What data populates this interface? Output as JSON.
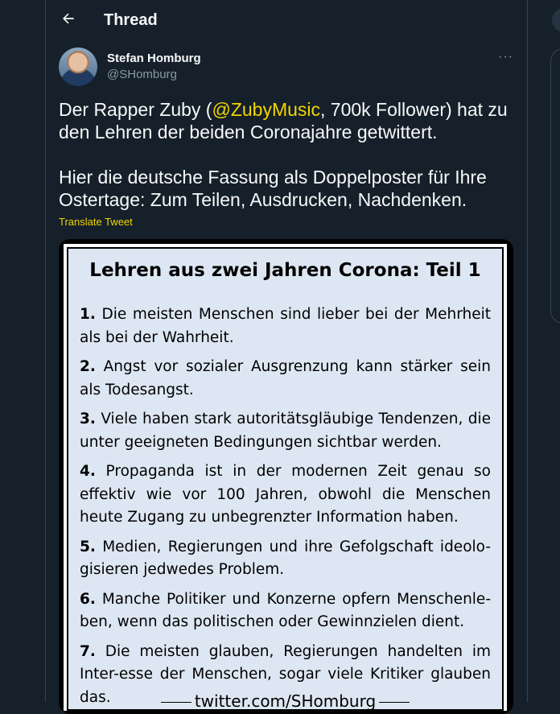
{
  "header": {
    "title": "Thread",
    "back_icon": "arrow-left-icon"
  },
  "author": {
    "name": "Stefan Homburg",
    "handle": "@SHomburg",
    "more_label": "···"
  },
  "tweet": {
    "p1_before": "Der Rapper Zuby (",
    "mention": "@ZubyMusic",
    "p1_after": ", 700k Follower) hat zu den Lehren der beiden Coronajahre getwittert.",
    "p2": "Hier die deutsche Fassung als Doppelposter für Ihre Ostertage: Zum Teilen, Ausdrucken, Nachdenken.",
    "translate_label": "Translate Tweet"
  },
  "poster": {
    "title": "Lehren aus zwei Jahren Corona: Teil 1",
    "lessons": [
      {
        "num": "1.",
        "text": " Die meisten Menschen sind lieber bei der Mehrheit als bei der Wahrheit."
      },
      {
        "num": "2.",
        "text": " Angst vor sozialer Ausgrenzung kann stärker sein als Todesangst."
      },
      {
        "num": "3.",
        "text": " Viele haben stark autoritätsgläubige Tendenzen, die unter geeigneten Bedingungen sichtbar werden."
      },
      {
        "num": "4.",
        "text": " Propaganda ist in der modernen Zeit genau so effektiv wie vor 100 Jahren, obwohl die Menschen heute Zugang zu unbegrenzter Information haben."
      },
      {
        "num": "5.",
        "text": " Medien, Regierungen und ihre Gefolgschaft ideolo-gisieren jedwedes Problem."
      },
      {
        "num": "6.",
        "text": " Manche Politiker und Konzerne opfern Menschenle-ben, wenn das politischen oder Gewinnzielen dient."
      },
      {
        "num": "7.",
        "text": " Die meisten glauben, Regierungen handelten im Inter-esse der Menschen, sogar viele Kritiker glauben das."
      }
    ],
    "footer": "twitter.com/SHomburg"
  },
  "colors": {
    "background": "#15202b",
    "accent": "#f2d500",
    "muted": "#8b98a5"
  }
}
